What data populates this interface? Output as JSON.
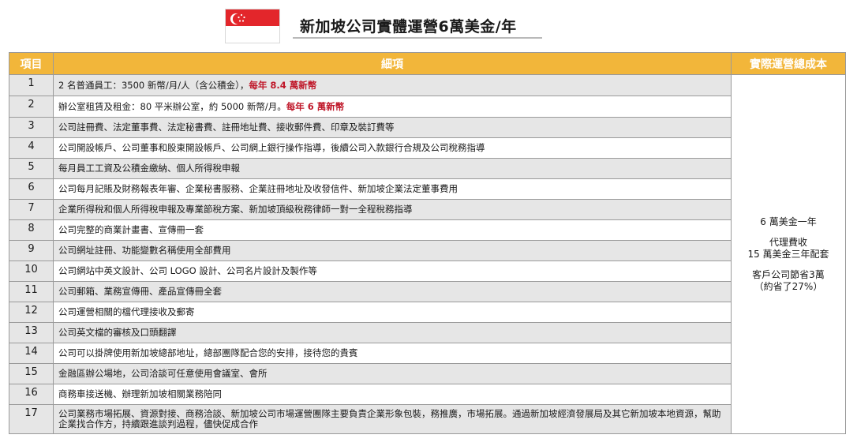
{
  "header": {
    "title": "新加坡公司實體運營6萬美金/年",
    "flag_colors": {
      "red": "#e3262b",
      "white": "#ffffff"
    }
  },
  "table": {
    "columns": [
      "項目",
      "細項",
      "實際運營總成本"
    ],
    "header_color": "#f2b63a",
    "highlight_color": "#c0182a",
    "rows": [
      {
        "num": "1",
        "text": "2 名普通員工：3500 新幣/月/人（含公積金），",
        "highlight": "每年 8.4 萬新幣"
      },
      {
        "num": "2",
        "text": "辦公室租賃及租金：80 平米辦公室，約 5000 新幣/月。",
        "highlight": "每年 6 萬新幣"
      },
      {
        "num": "3",
        "text": "公司註冊費、法定董事費、法定秘書費、註冊地址費、接收郵件費、印章及裝訂費等",
        "highlight": ""
      },
      {
        "num": "4",
        "text": "公司開設帳戶、公司董事和股東開設帳戶、公司網上銀行操作指導，後續公司入款銀行合規及公司稅務指導",
        "highlight": ""
      },
      {
        "num": "5",
        "text": "每月員工工資及公積金繳納、個人所得稅申報",
        "highlight": ""
      },
      {
        "num": "6",
        "text": "公司每月記賬及財務報表年審、企業秘書服務、企業註冊地址及收發信件、新加坡企業法定董事費用",
        "highlight": ""
      },
      {
        "num": "7",
        "text": "企業所得稅和個人所得稅申報及專業節稅方案、新加坡頂級稅務律師一對一全程稅務指導",
        "highlight": ""
      },
      {
        "num": "8",
        "text": "公司完整的商業計畫書、宣傳冊一套",
        "highlight": ""
      },
      {
        "num": "9",
        "text": "公司網址註冊、功能變數名稱使用全部費用",
        "highlight": ""
      },
      {
        "num": "10",
        "text": "公司網站中英文設計、公司 LOGO 設計、公司名片設計及製作等",
        "highlight": ""
      },
      {
        "num": "11",
        "text": "公司郵箱、業務宣傳冊、產品宣傳冊全套",
        "highlight": ""
      },
      {
        "num": "12",
        "text": "公司運營相關的檔代理接收及郵寄",
        "highlight": ""
      },
      {
        "num": "13",
        "text": "公司英文檔的審核及口頭翻譯",
        "highlight": ""
      },
      {
        "num": "14",
        "text": "公司可以掛牌使用新加坡總部地址，總部團隊配合您的安排，接待您的貴賓",
        "highlight": ""
      },
      {
        "num": "15",
        "text": "金融區辦公場地，公司洽談可任意使用會議室、會所",
        "highlight": ""
      },
      {
        "num": "16",
        "text": "商務車接送機、辦理新加坡相關業務陪同",
        "highlight": ""
      },
      {
        "num": "17",
        "text": "公司業務市場拓展、資源對接、商務洽談、新加坡公司市場運營團隊主要負責企業形象包裝，務推廣，市場拓展。通過新加坡經濟發展局及其它新加坡本地資源，幫助企業找合作方，持續跟進談判過程，儘快促成合作",
        "highlight": ""
      }
    ],
    "cost": {
      "line1": "6 萬美金一年",
      "line2": "代理費收",
      "line3": "15 萬美金三年配套",
      "line4": "客戶公司節省3萬",
      "line5": "（約省了27%）"
    }
  }
}
